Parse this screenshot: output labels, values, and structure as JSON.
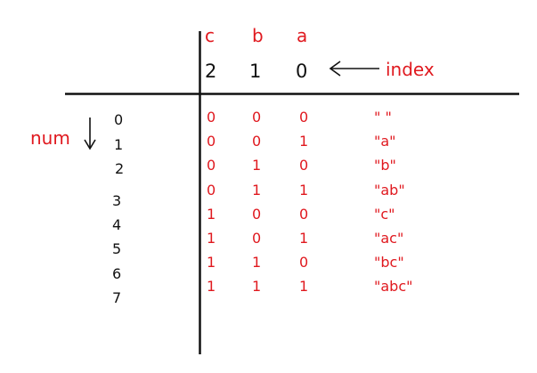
{
  "diagram": {
    "columns": [
      {
        "letter": "c",
        "index": "2"
      },
      {
        "letter": "b",
        "index": "1"
      },
      {
        "letter": "a",
        "index": "0"
      }
    ],
    "index_label": "index",
    "num_label": "num",
    "rows": [
      {
        "num": "0",
        "bits": [
          "0",
          "0",
          "0"
        ],
        "subset": "\" \""
      },
      {
        "num": "1",
        "bits": [
          "0",
          "0",
          "1"
        ],
        "subset": "\"a\""
      },
      {
        "num": "2",
        "bits": [
          "0",
          "1",
          "0"
        ],
        "subset": "\"b\""
      },
      {
        "num": "3",
        "bits": [
          "0",
          "1",
          "1"
        ],
        "subset": "\"ab\""
      },
      {
        "num": "4",
        "bits": [
          "1",
          "0",
          "0"
        ],
        "subset": "\"c\""
      },
      {
        "num": "5",
        "bits": [
          "1",
          "0",
          "1"
        ],
        "subset": "\"ac\""
      },
      {
        "num": "6",
        "bits": [
          "1",
          "1",
          "0"
        ],
        "subset": "\"bc\""
      },
      {
        "num": "7",
        "bits": [
          "1",
          "1",
          "1"
        ],
        "subset": "\"abc\""
      }
    ],
    "colors": {
      "accent": "#e0191f",
      "ink": "#111111"
    }
  }
}
